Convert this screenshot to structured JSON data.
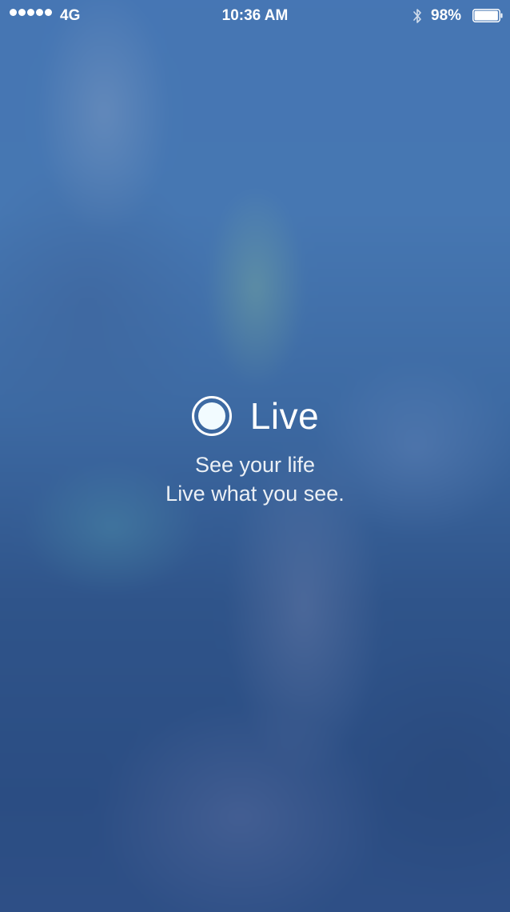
{
  "status_bar": {
    "signal_dots": 5,
    "carrier": "4G",
    "time": "10:36  AM",
    "battery_percent": "98%",
    "battery_level": 0.98,
    "bluetooth_icon": "bluetooth-icon",
    "battery_icon": "battery-icon"
  },
  "splash": {
    "logo_icon": "live-record-icon",
    "app_name": "Live",
    "tagline_line1": "See your life",
    "tagline_line2": "Live what you see."
  },
  "colors": {
    "background": "#3f68a0",
    "text": "#ffffff"
  }
}
